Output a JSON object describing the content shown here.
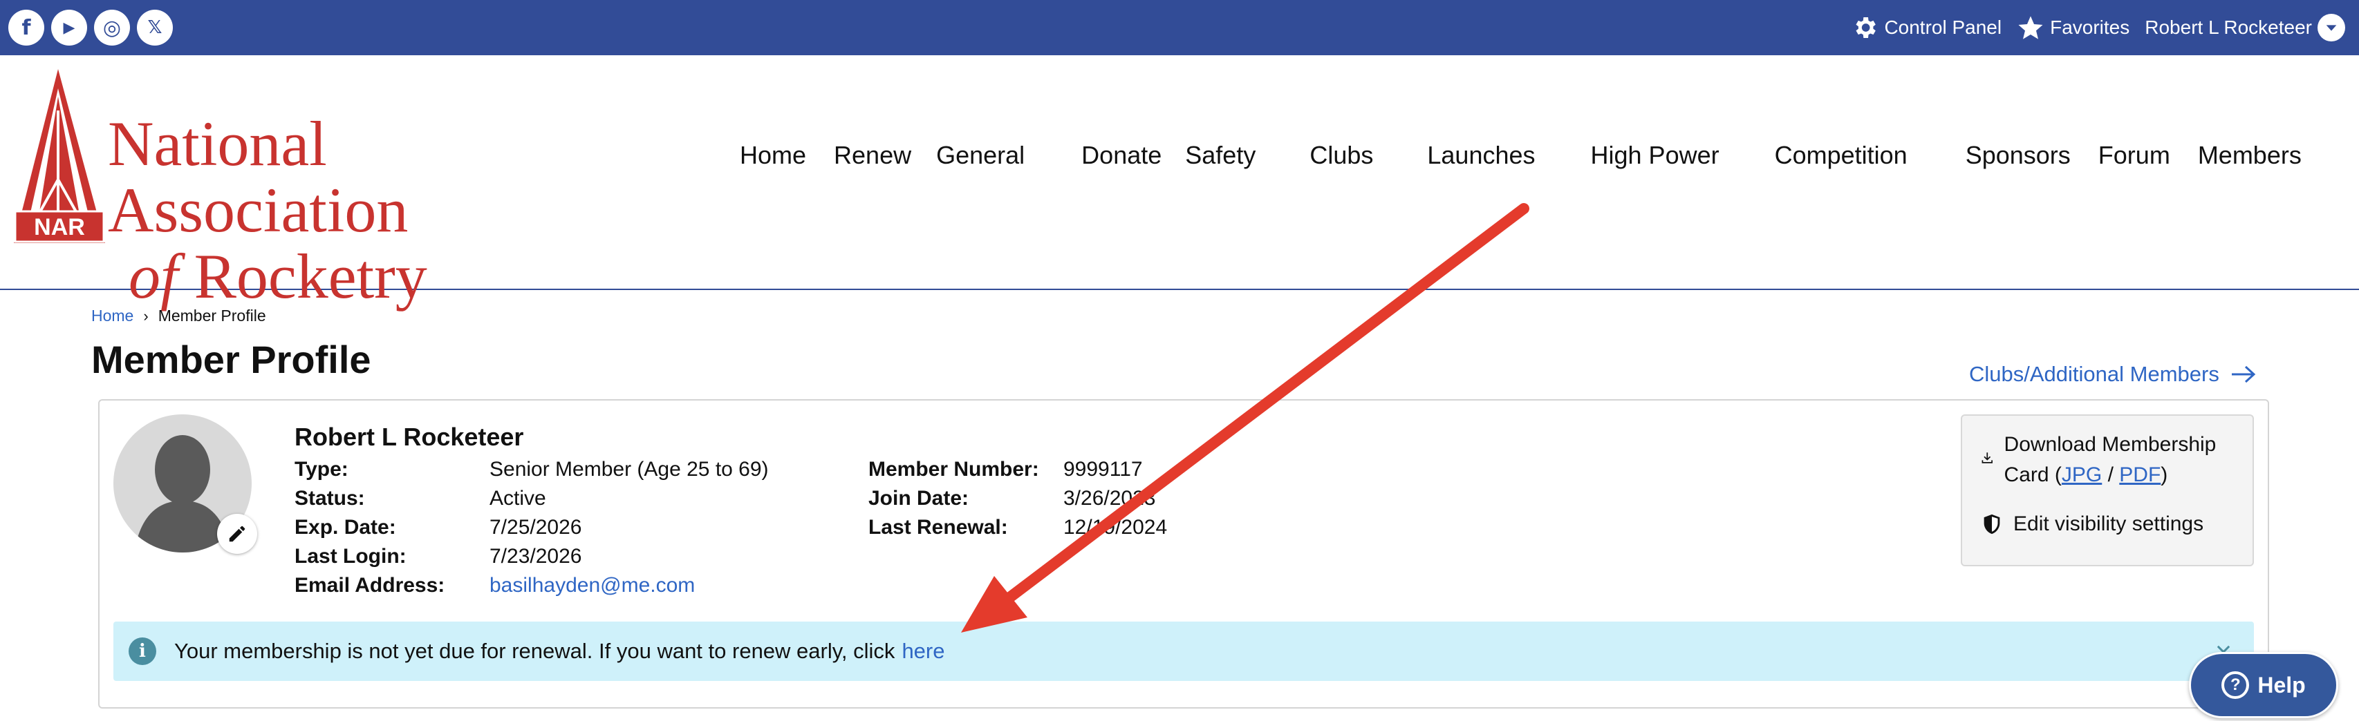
{
  "topbar": {
    "social": [
      {
        "icon": "facebook-icon",
        "glyph": "f"
      },
      {
        "icon": "youtube-icon",
        "glyph": "▶"
      },
      {
        "icon": "instagram-icon",
        "glyph": "◎"
      },
      {
        "icon": "x-twitter-icon",
        "glyph": "𝕏"
      }
    ],
    "control_panel": "Control Panel",
    "favorites": "Favorites",
    "user_name": "Robert L Rocketeer"
  },
  "logo": {
    "line1": "National Association",
    "line2_of": "of",
    "line2": "Rocketry",
    "badge": "NAR"
  },
  "nav": {
    "items": [
      "Home",
      "Renew",
      "General",
      "Donate",
      "Safety",
      "Clubs",
      "Launches",
      "High Power",
      "Competition",
      "Sponsors",
      "Forum",
      "Members"
    ]
  },
  "breadcrumb": {
    "home": "Home",
    "current": "Member Profile"
  },
  "page_title": "Member Profile",
  "clubs_link": "Clubs/Additional Members",
  "member": {
    "name": "Robert L Rocketeer",
    "type_label": "Type:",
    "type": "Senior Member (Age 25 to 69)",
    "status_label": "Status:",
    "status": "Active",
    "exp_label": "Exp. Date:",
    "exp": "7/25/2026",
    "login_label": "Last Login:",
    "login": "7/23/2026",
    "email_label": "Email Address:",
    "email": "basilhayden@me.com",
    "number_label": "Member Number:",
    "number": "9999117",
    "join_label": "Join Date:",
    "join": "3/26/2023",
    "renewal_label": "Last Renewal:",
    "renewal": "12/19/2024"
  },
  "side": {
    "download_label": "Download Membership Card (",
    "jpg": "JPG",
    "slash": " / ",
    "pdf": "PDF",
    "close_paren": ")",
    "visibility": "Edit visibility settings"
  },
  "alert": {
    "text": "Your membership is not yet due for renewal. If you want to renew early, click",
    "link": "here"
  },
  "help": {
    "label": "Help"
  },
  "colors": {
    "topbar": "#324c97",
    "brand_red": "#c8332f",
    "link": "#2f66c4",
    "alert_bg": "#cff1fa",
    "annotation_arrow": "#e43b2c"
  }
}
